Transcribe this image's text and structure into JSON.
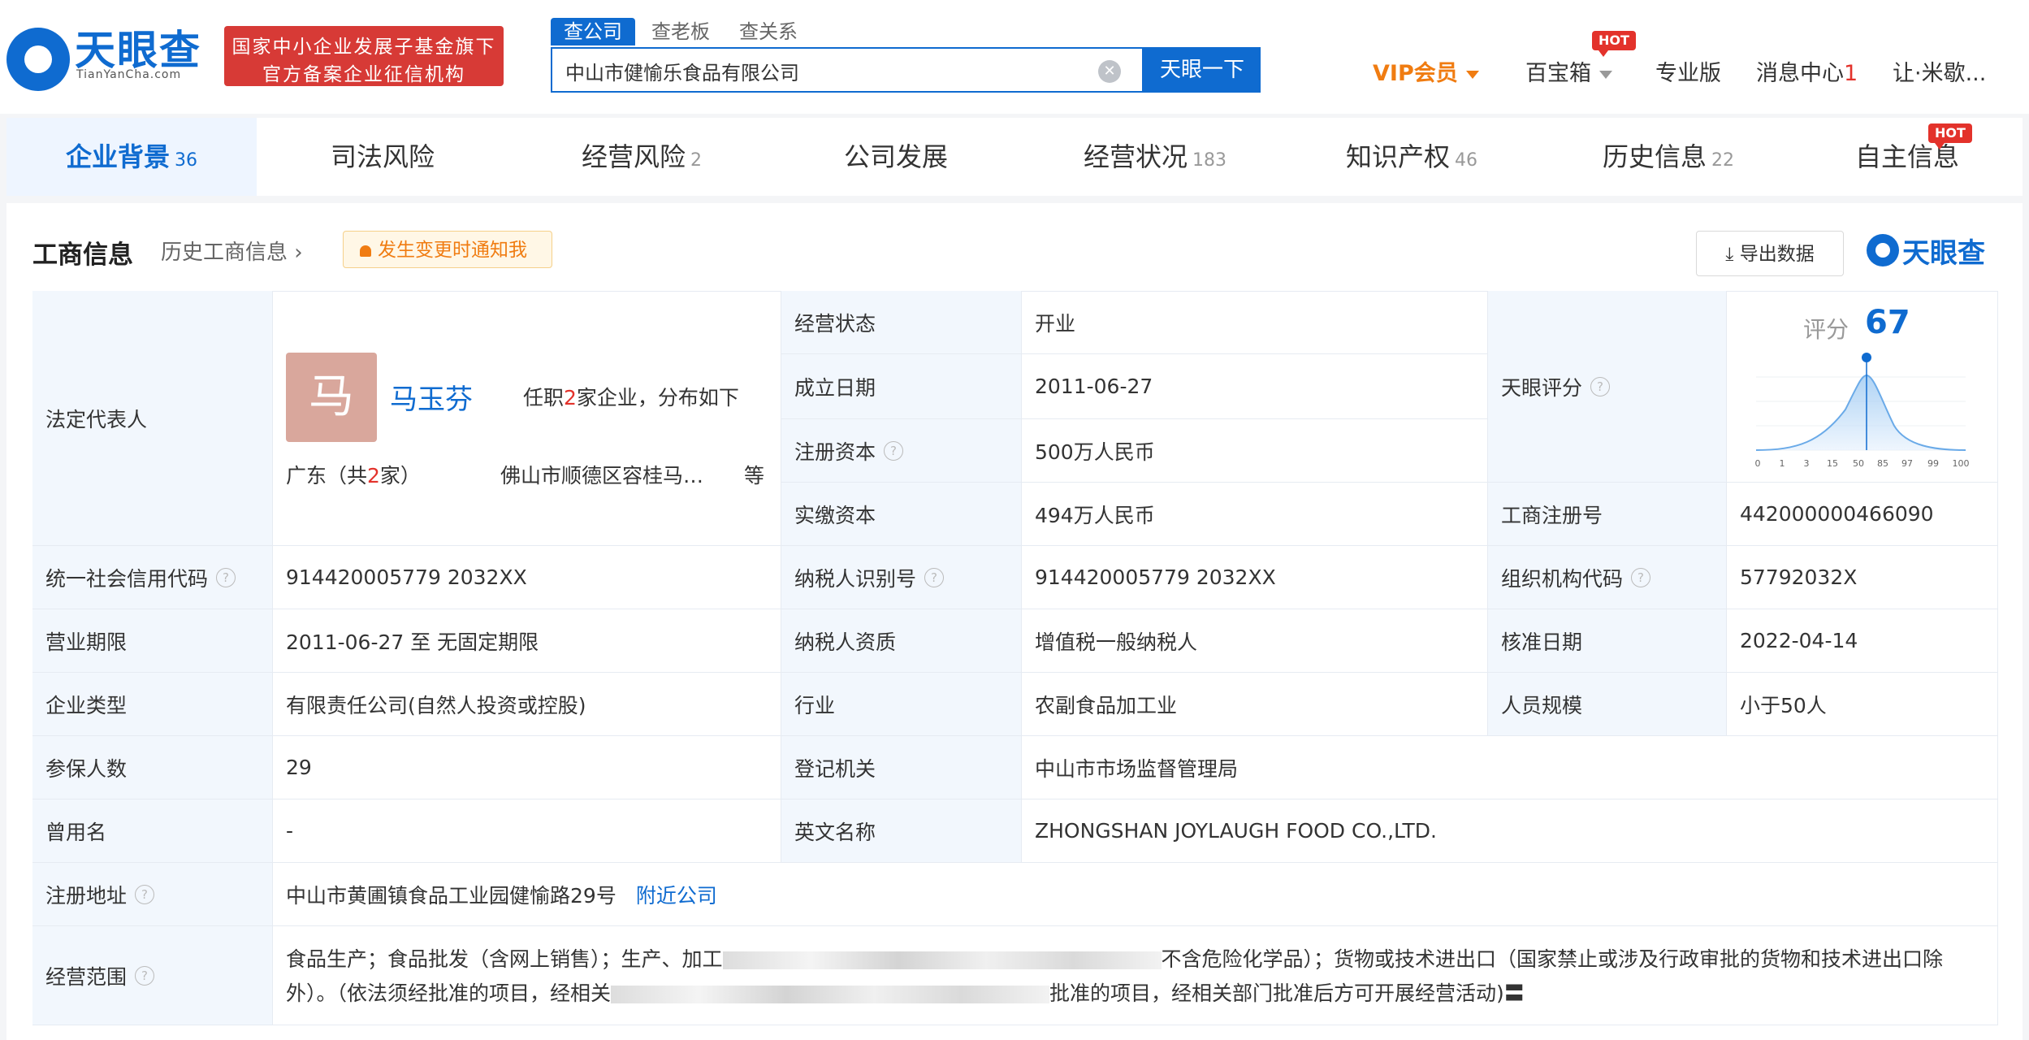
{
  "brand": {
    "logo_text": "天眼查",
    "logo_domain": "TianYanCha.com",
    "badge_line1": "国家中小企业发展子基金旗下",
    "badge_line2": "官方备案企业征信机构",
    "corner_brand": "天眼查"
  },
  "search": {
    "tabs": [
      "查公司",
      "查老板",
      "查关系"
    ],
    "query": "中山市健愉乐食品有限公司",
    "button": "天眼一下"
  },
  "topnav": {
    "vip": "VIP会员",
    "treasure": "百宝箱",
    "hot": "HOT",
    "pro": "专业版",
    "messages": "消息中心",
    "message_count": "1",
    "user": "让·米歇..."
  },
  "tabs": [
    {
      "label": "企业背景",
      "count": "36"
    },
    {
      "label": "司法风险",
      "count": ""
    },
    {
      "label": "经营风险",
      "count": "2"
    },
    {
      "label": "公司发展",
      "count": ""
    },
    {
      "label": "经营状况",
      "count": "183"
    },
    {
      "label": "知识产权",
      "count": "46"
    },
    {
      "label": "历史信息",
      "count": "22"
    },
    {
      "label": "自主信息",
      "count": ""
    }
  ],
  "tab_hot": "HOT",
  "section": {
    "title": "工商信息",
    "history_link": "历史工商信息",
    "notify": "发生变更时通知我",
    "export": "导出数据"
  },
  "legal_rep": {
    "label": "法定代表人",
    "avatar_char": "马",
    "name": "马玉芬",
    "posts_prefix": "任职",
    "posts_count": "2",
    "posts_suffix": "家企业，分布如下",
    "region_prefix": "广东（共",
    "region_count": "2",
    "region_suffix": "家）",
    "city": "佛山市顺德区容桂马…",
    "more": "等"
  },
  "fields": {
    "status_label": "经营状态",
    "status": "开业",
    "found_label": "成立日期",
    "found": "2011-06-27",
    "reg_cap_label": "注册资本",
    "reg_cap": "500万人民币",
    "paid_cap_label": "实缴资本",
    "paid_cap": "494万人民币",
    "score_label": "天眼评分",
    "reg_no_label": "工商注册号",
    "reg_no": "442000000466090",
    "credit_label": "统一社会信用代码",
    "credit": "914420005779 2032XX",
    "taxid_label": "纳税人识别号",
    "taxid": "914420005779 2032XX",
    "org_label": "组织机构代码",
    "org": "57792032X",
    "term_label": "营业期限",
    "term": "2011-06-27 至 无固定期限",
    "tax_quality_label": "纳税人资质",
    "tax_quality": "增值税一般纳税人",
    "approve_label": "核准日期",
    "approve": "2022-04-14",
    "type_label": "企业类型",
    "type": "有限责任公司(自然人投资或控股)",
    "industry_label": "行业",
    "industry": "农副食品加工业",
    "staff_label": "人员规模",
    "staff": "小于50人",
    "insured_label": "参保人数",
    "insured": "29",
    "authority_label": "登记机关",
    "authority": "中山市市场监督管理局",
    "former_label": "曾用名",
    "former": "-",
    "en_label": "英文名称",
    "en": "ZHONGSHAN JOYLAUGH FOOD CO.,LTD.",
    "addr_label": "注册地址",
    "addr": "中山市黄圃镇食品工业园健愉路29号",
    "nearby": "附近公司",
    "scope_label": "经营范围",
    "scope_part1": "食品生产；食品批发（含网上销售）；生产、加工",
    "scope_part2": "不含危险化学品）；货物或技术进出口（国家禁止或涉及行政审批的货物和技术进出口除外）。（依法须经批准的项目，经相关",
    "scope_part3": "批准的项目，经相关部门批准后方可开展经营活动)〓"
  },
  "score": {
    "label": "评分",
    "value": 67,
    "axis_ticks": [
      "0",
      "1",
      "3",
      "15",
      "50",
      "85",
      "97",
      "99",
      "100"
    ]
  }
}
